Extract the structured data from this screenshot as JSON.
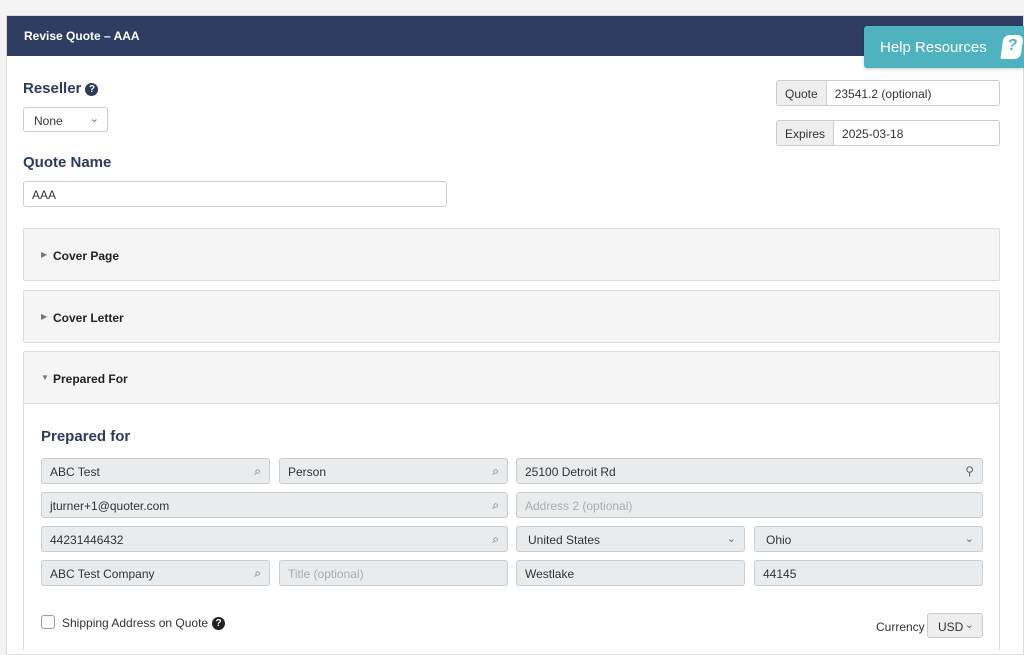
{
  "window": {
    "title": "Revise Quote – AAA"
  },
  "help": {
    "label": "Help Resources",
    "icon": "question-bubble-icon",
    "icon_glyph": "?"
  },
  "reseller": {
    "heading": "Reseller",
    "help_glyph": "?",
    "selected": "None"
  },
  "quote_number": {
    "label": "Quote",
    "placeholder": "23541.2 (optional)"
  },
  "expires": {
    "label": "Expires",
    "value": "2025-03-18"
  },
  "quote_name": {
    "heading": "Quote Name",
    "value": "AAA"
  },
  "panels": {
    "cover_page": "Cover Page",
    "cover_letter": "Cover Letter",
    "prepared_for": "Prepared For"
  },
  "prepared_for": {
    "heading": "Prepared for",
    "organization": "ABC Test",
    "person": "Person",
    "address1": "25100 Detroit Rd",
    "email": "jturner+1@quoter.com",
    "address2_placeholder": "Address 2 (optional)",
    "phone": "44231446432",
    "country": "United States",
    "state": "Ohio",
    "company": "ABC Test Company",
    "title_placeholder": "Title (optional)",
    "city": "Westlake",
    "zip": "44145"
  },
  "shipping": {
    "label": "Shipping Address on Quote",
    "help_glyph": "?"
  },
  "currency": {
    "label": "Currency",
    "selected": "USD"
  },
  "glyphs": {
    "search": "⌕",
    "pin": "⚲",
    "chevron": "⌄",
    "caret_right": "▶",
    "caret_down": "▼"
  }
}
